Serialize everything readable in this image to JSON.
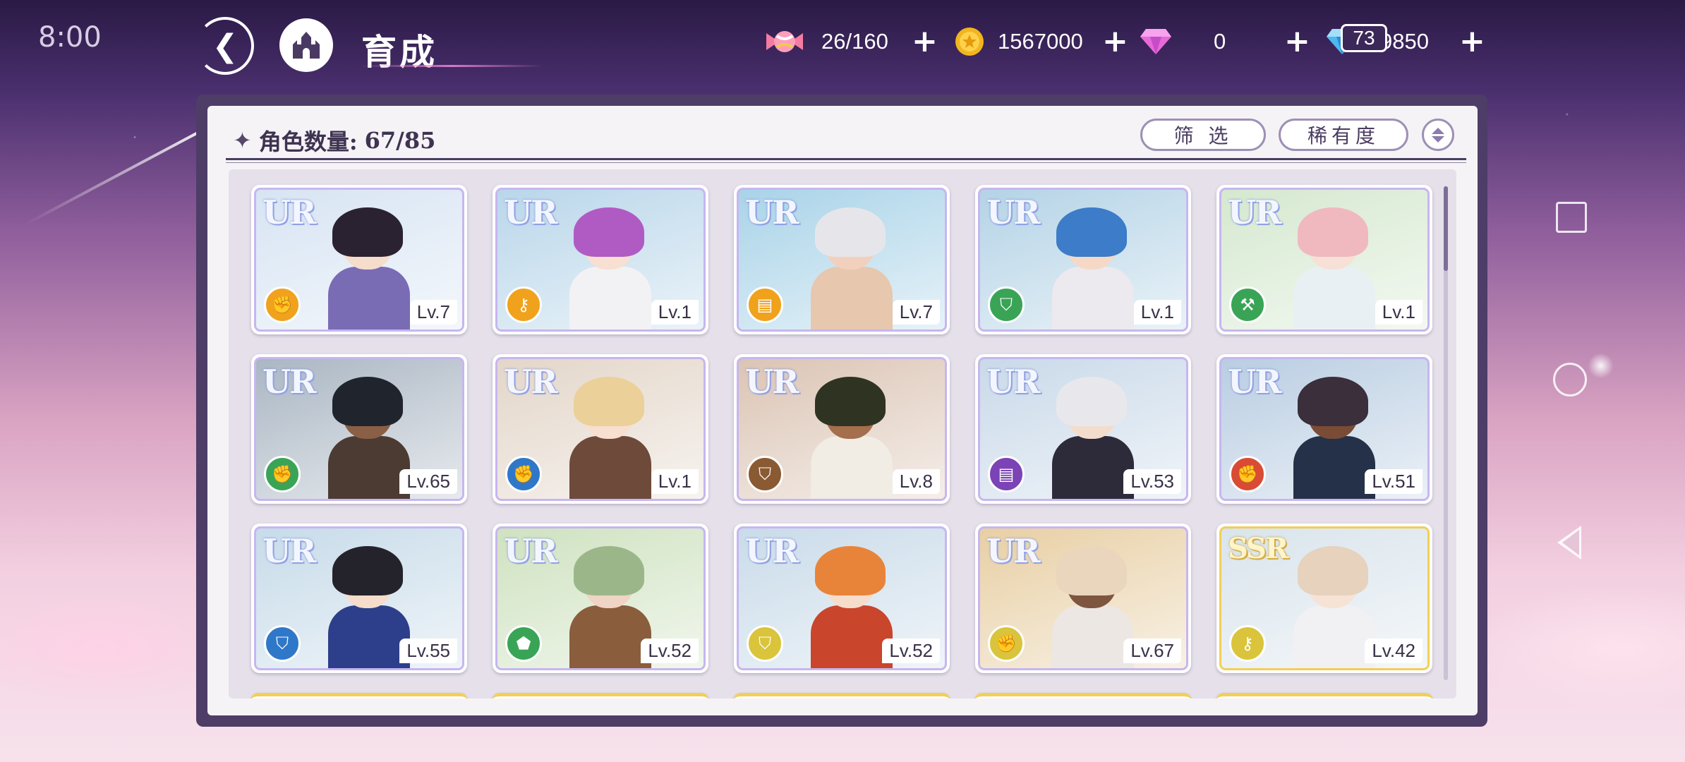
{
  "status_bar": {
    "time": "8:00"
  },
  "header": {
    "title": "育成",
    "back_icon": "back-arrow-icon",
    "home_icon": "castle-icon"
  },
  "resources": {
    "candy": {
      "icon": "candy-icon",
      "value": "26/160"
    },
    "coins": {
      "icon": "coin-icon",
      "value": "1567000"
    },
    "gems": {
      "icon": "diamond-icon",
      "value": "0"
    },
    "crystals": {
      "icon": "diamond-icon",
      "value": "9850",
      "badge": "73"
    }
  },
  "panel": {
    "count_label": "角色数量:",
    "count_value": "67/85",
    "filter_label": "筛 选",
    "sort_label": "稀有度"
  },
  "colors": {
    "accent": "#4d3d67",
    "ur_frame": "#c7b6f0",
    "ssr_frame": "#f2cf56",
    "element_orange": "#f0a21c",
    "element_green": "#3aa456",
    "element_blue": "#2f78c9",
    "element_brown": "#8a5a33",
    "element_purple": "#7b43b6",
    "element_red": "#d94b34",
    "element_yellow": "#d9c43c"
  },
  "characters": [
    {
      "rarity": "UR",
      "level": "Lv.7",
      "element_icon": "fist-icon",
      "element_color": "#f0a21c",
      "hair": "#2a2230",
      "skin": "#f6dccb",
      "outfit": "#7a6bb5",
      "bg": "#d7e4f3"
    },
    {
      "rarity": "UR",
      "level": "Lv.1",
      "element_icon": "key-icon",
      "element_color": "#f0a21c",
      "hair": "#b05bc4",
      "skin": "#f7dfd2",
      "outfit": "#f2f2f4",
      "bg": "#b9d6ea"
    },
    {
      "rarity": "UR",
      "level": "Lv.7",
      "element_icon": "book-icon",
      "element_color": "#f0a21c",
      "hair": "#e6e6ea",
      "skin": "#f1d1bd",
      "outfit": "#e7c7ae",
      "bg": "#a9d3e8"
    },
    {
      "rarity": "UR",
      "level": "Lv.1",
      "element_icon": "shield-icon",
      "element_color": "#3aa456",
      "hair": "#3c7cc9",
      "skin": "#f5d9c6",
      "outfit": "#ece9ef",
      "bg": "#b4d3e6"
    },
    {
      "rarity": "UR",
      "level": "Lv.1",
      "element_icon": "hammer-icon",
      "element_color": "#3aa456",
      "hair": "#f0b9bf",
      "skin": "#f7e0d6",
      "outfit": "#e9f0f4",
      "bg": "#d5e8cf"
    },
    {
      "rarity": "UR",
      "level": "Lv.65",
      "element_icon": "fist-icon",
      "element_color": "#3aa456",
      "hair": "#20242c",
      "skin": "#8a5f45",
      "outfit": "#4b3b33",
      "bg": "#aab6c3"
    },
    {
      "rarity": "UR",
      "level": "Lv.1",
      "element_icon": "fist-icon",
      "element_color": "#2f78c9",
      "hair": "#ecd09a",
      "skin": "#f7e0cf",
      "outfit": "#6e4a3a",
      "bg": "#e3d6c9"
    },
    {
      "rarity": "UR",
      "level": "Lv.8",
      "element_icon": "shield-icon",
      "element_color": "#8a5a33",
      "hair": "#2f3322",
      "skin": "#a56e4c",
      "outfit": "#f1ece4",
      "bg": "#dbc4b4"
    },
    {
      "rarity": "UR",
      "level": "Lv.53",
      "element_icon": "book-icon",
      "element_color": "#7b43b6",
      "hair": "#e8e8ec",
      "skin": "#f4dccd",
      "outfit": "#2d2a3a",
      "bg": "#c9d9e9"
    },
    {
      "rarity": "UR",
      "level": "Lv.51",
      "element_icon": "fist-icon",
      "element_color": "#d94b34",
      "hair": "#3a2f3a",
      "skin": "#7a4c35",
      "outfit": "#253148",
      "bg": "#b9cde2"
    },
    {
      "rarity": "UR",
      "level": "Lv.55",
      "element_icon": "shield-icon",
      "element_color": "#2f78c9",
      "hair": "#24232b",
      "skin": "#f6dccb",
      "outfit": "#2d3f8a",
      "bg": "#c7dbe9"
    },
    {
      "rarity": "UR",
      "level": "Lv.52",
      "element_icon": "boot-icon",
      "element_color": "#3aa456",
      "hair": "#9bb78a",
      "skin": "#f0d4c4",
      "outfit": "#8a5d3c",
      "bg": "#cfe2c0"
    },
    {
      "rarity": "UR",
      "level": "Lv.52",
      "element_icon": "shield-icon",
      "element_color": "#d9c43c",
      "hair": "#e8843a",
      "skin": "#f6dccb",
      "outfit": "#c9452c",
      "bg": "#c9dbe9"
    },
    {
      "rarity": "UR",
      "level": "Lv.67",
      "element_icon": "fist-icon",
      "element_color": "#d9c43c",
      "hair": "#e9d6bd",
      "skin": "#7e553f",
      "outfit": "#ece7e2",
      "bg": "#e8cfa4"
    },
    {
      "rarity": "SSR",
      "level": "Lv.42",
      "element_icon": "key-icon",
      "element_color": "#d9c43c",
      "hair": "#e6d2bd",
      "skin": "#f7e3d6",
      "outfit": "#f1f0f3",
      "bg": "#d9e4ec"
    }
  ],
  "nav_bar": {
    "recent_icon": "square-icon",
    "home_icon": "circle-icon",
    "back_icon": "triangle-back-icon"
  }
}
